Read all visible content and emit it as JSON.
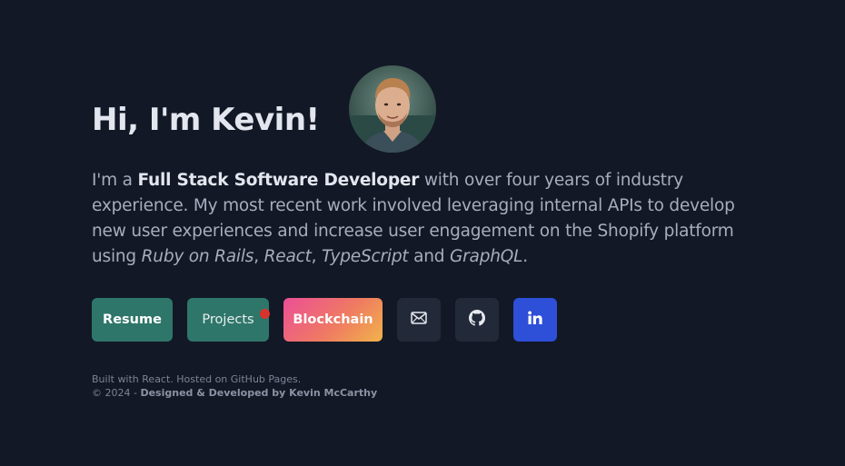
{
  "hero": {
    "title": "Hi, I'm Kevin!"
  },
  "intro": {
    "part1": "I'm a ",
    "role": "Full Stack Software Developer",
    "part2": " with over four years of industry experience. My most recent work involved leveraging internal APIs to develop new user experiences and increase user engagement on the Shopify platform using ",
    "tech1": "Ruby on Rails",
    "sep1": ", ",
    "tech2": "React",
    "sep2": ", ",
    "tech3": "TypeScript",
    "sep3": " and ",
    "tech4": "GraphQL",
    "end": "."
  },
  "actions": {
    "resume_label": "Resume",
    "projects_label": "Projects",
    "blockchain_label": "Blockchain",
    "email_icon": "mail-icon",
    "github_icon": "github-icon",
    "linkedin_icon": "linkedin-icon"
  },
  "footer": {
    "line1": "Built with React. Hosted on GitHub Pages.",
    "copyright": "© 2024 - ",
    "credit": "Designed & Developed by Kevin McCarthy"
  },
  "colors": {
    "background": "#121826",
    "teal": "#2f766a",
    "linkedin_blue": "#2e4fd8",
    "notification_red": "#d8342c"
  }
}
